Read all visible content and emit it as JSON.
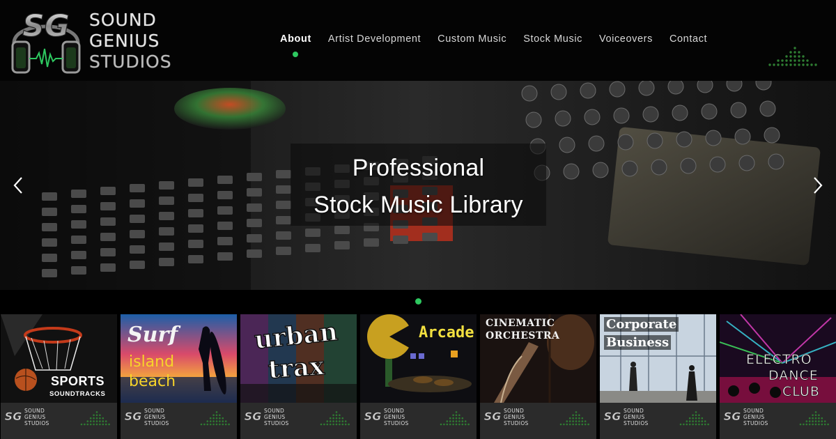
{
  "brand": {
    "logo_mark": "SG",
    "lines": [
      "SOUND",
      "GENIUS",
      "STUDIOS"
    ]
  },
  "nav": {
    "items": [
      {
        "label": "About",
        "active": true
      },
      {
        "label": "Artist Development",
        "active": false
      },
      {
        "label": "Custom Music",
        "active": false
      },
      {
        "label": "Stock Music",
        "active": false
      },
      {
        "label": "Voiceovers",
        "active": false
      },
      {
        "label": "Contact",
        "active": false
      }
    ]
  },
  "hero": {
    "line1": "Professional",
    "line2": "Stock Music Library",
    "prev_icon": "chevron-left-icon",
    "next_icon": "chevron-right-icon"
  },
  "albums": [
    {
      "title_a": "SPORTS",
      "title_b": "SOUNDTRACKS"
    },
    {
      "title_a": "Surf",
      "title_b": "island",
      "title_c": "beach"
    },
    {
      "title_a": "urban",
      "title_b": "trax"
    },
    {
      "title_a": "Arcade"
    },
    {
      "title_a": "CINEMATIC",
      "title_b": "ORCHESTRA"
    },
    {
      "title_a": "Corporate",
      "title_b": "Business"
    },
    {
      "title_a": "ELECTRO",
      "title_b": "DANCE",
      "title_c": "CLUB"
    }
  ],
  "album_footer": {
    "mark": "SG",
    "lines": [
      "SOUND",
      "GENIUS",
      "STUDIOS"
    ]
  },
  "colors": {
    "accent": "#2ec860",
    "header_bg": "#040404",
    "footer_bg": "#2b2b2b"
  }
}
